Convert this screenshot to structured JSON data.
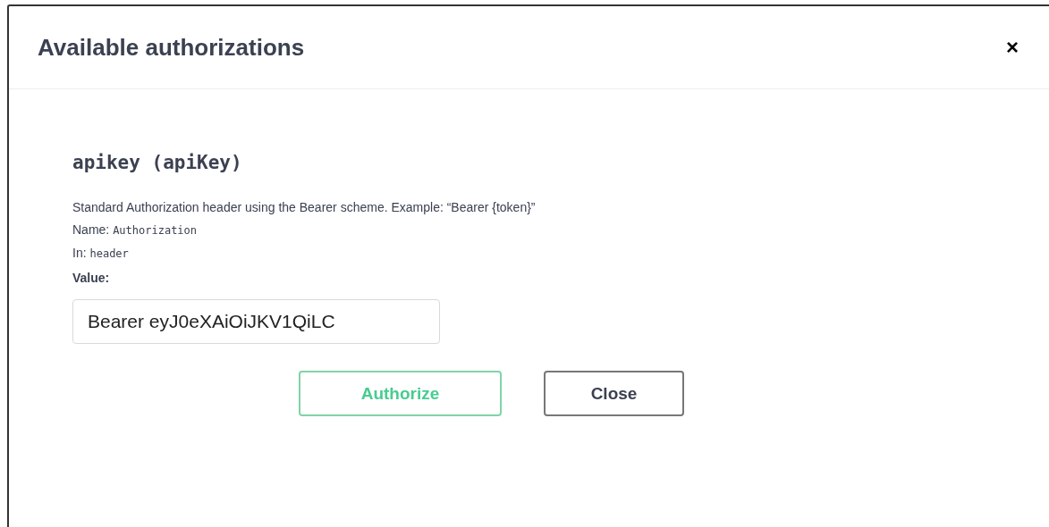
{
  "dialog": {
    "title": "Available authorizations",
    "close_icon": "×"
  },
  "scheme": {
    "title": "apikey (apiKey)",
    "description": "Standard Authorization header using the Bearer scheme. Example: “Bearer {token}”",
    "name_label": "Name:",
    "name_value": "Authorization",
    "in_label": "In:",
    "in_value": "header",
    "value_label": "Value:",
    "value": "Bearer eyJ0eXAiOiJKV1QiLC"
  },
  "buttons": [
    {
      "label": "Authorize",
      "kind": "primary"
    },
    {
      "label": "Close",
      "kind": "secondary"
    }
  ]
}
